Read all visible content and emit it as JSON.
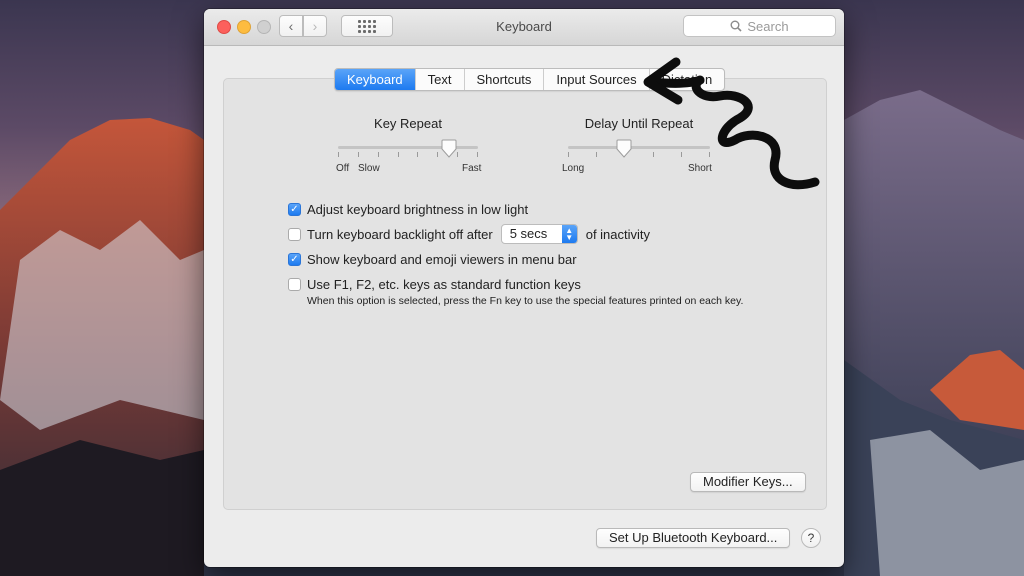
{
  "window": {
    "title": "Keyboard",
    "search_placeholder": "Search"
  },
  "tabs": [
    {
      "label": "Keyboard",
      "active": true
    },
    {
      "label": "Text",
      "active": false
    },
    {
      "label": "Shortcuts",
      "active": false
    },
    {
      "label": "Input Sources",
      "active": false
    },
    {
      "label": "Dictation",
      "active": false
    }
  ],
  "key_repeat": {
    "title": "Key Repeat",
    "labels": {
      "off": "Off",
      "slow": "Slow",
      "fast": "Fast"
    },
    "level": 0.8
  },
  "delay_until_repeat": {
    "title": "Delay Until Repeat",
    "labels": {
      "long": "Long",
      "short": "Short"
    },
    "level": 0.4
  },
  "options": [
    {
      "label": "Adjust keyboard brightness in low light",
      "checked": true
    },
    {
      "label": "Turn keyboard backlight off after",
      "checked": false,
      "select_value": "5 secs",
      "suffix": "of inactivity"
    },
    {
      "label": "Show keyboard and emoji viewers in menu bar",
      "checked": true
    },
    {
      "label": "Use F1, F2, etc. keys as standard function keys",
      "checked": false,
      "note": "When this option is selected, press the Fn key to use the special features printed on each key."
    }
  ],
  "buttons": {
    "modifier_keys": "Modifier Keys...",
    "bluetooth": "Set Up Bluetooth Keyboard...",
    "help": "?"
  },
  "colors": {
    "accent": "#1d7af0",
    "close": "#fc605c",
    "minimize": "#fdbc40"
  }
}
